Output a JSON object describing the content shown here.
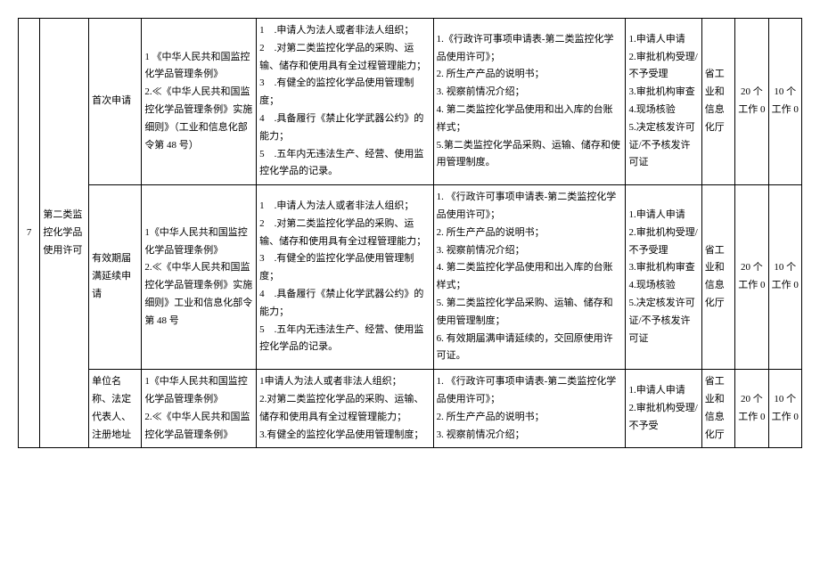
{
  "row_index": "7",
  "item_name": "第二类监控化学品使用许可",
  "rows": [
    {
      "sub": "首次申请",
      "basis": "1 《中华人民共和国监控化学品管理条例》\n2.≪《中华人民共和国监控化学品管理条例》实施细则》（工业和信息化部令第 48 号）",
      "cond": "1　.申请人为法人或者非法人组织；\n2　.对第二类监控化学品的采购、运输、储存和使用具有全过程管理能力；\n3　.有健全的监控化学品使用管理制度；\n4　.具备履行《禁止化学武器公约》的能力；\n5　.五年内无违法生产、经营、使用监控化学品的记录。",
      "mat": "1.《行政许可事项申请表-第二类监控化学品使用许可》；\n2. 所生产产品的说明书；\n3. 视察前情况介绍；\n4. 第二类监控化学品使用和出入库的台账样式；\n5.第二类监控化学品采购、运输、储存和使用管理制度。",
      "proc": "1.申请人申请\n2.审批机构受理/不予受理\n3.审批机构审查\n4.现场核验\n5.决定核发许可证/不予核发许可证",
      "dept": "省工业和信息化厅",
      "d1": "20 个工作 0",
      "d2": "10 个工作 0"
    },
    {
      "sub": "有效期届满延续申请",
      "basis": "1《中华人民共和国监控化学品管理条例》\n2.≪《中华人民共和国监控化学品管理条例》实施细则》工业和信息化部令第 48 号",
      "cond": "1　.申请人为法人或者非法人组织；\n2　.对第二类监控化学品的采购、运输、储存和使用具有全过程管理能力；\n3　.有健全的监控化学品使用管理制度；\n4　.具备履行《禁止化学武器公约》的能力；\n5　.五年内无违法生产、经营、使用监控化学品的记录。",
      "mat": "1. 《行政许可事项申请表-第二类监控化学品使用许可》；\n2. 所生产产品的说明书；\n3. 视察前情况介绍；\n4. 第二类监控化学品使用和出入库的台账样式；\n5. 第二类监控化学品采购、运输、储存和使用管理制度；\n6. 有效期届满申请延续的，交回原使用许可证。",
      "proc": "1.申请人申请\n2.审批机构受理/不予受理\n3.审批机构审查\n4.现场核验\n5.决定核发许可证/不予核发许可证",
      "dept": "省工业和信息化厅",
      "d1": "20 个工作 0",
      "d2": "10 个工作 0"
    },
    {
      "sub": "单位名称、法定代表人、注册地址",
      "basis": "1《中华人民共和国监控化学品管理条例》\n2.≪《中华人民共和国监控化学品管理条例》",
      "cond": "1申请人为法人或者非法人组织；\n2.对第二类监控化学品的采购、运输、储存和使用具有全过程管理能力；\n3.有健全的监控化学品使用管理制度；",
      "mat": "1. 《行政许可事项申请表-第二类监控化学品使用许可》；\n2. 所生产产品的说明书；\n3. 视察前情况介绍；",
      "proc": "1.申请人申请\n2.审批机构受理/不予受",
      "dept": "省工业和信息化厅",
      "d1": "20 个工作 0",
      "d2": "10 个工作 0"
    }
  ]
}
